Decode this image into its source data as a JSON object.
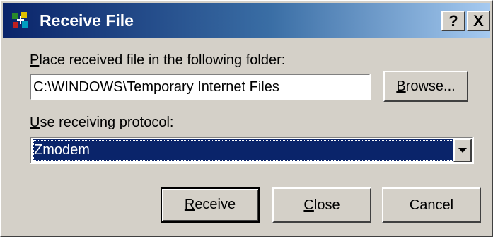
{
  "window": {
    "title": "Receive File",
    "help_label": "?",
    "close_label": "X"
  },
  "folder": {
    "label_accel": "P",
    "label_rest": "lace received file in the following folder:",
    "value": "C:\\WINDOWS\\Temporary Internet Files"
  },
  "browse_button": {
    "accel": "B",
    "rest": "rowse..."
  },
  "protocol": {
    "label_accel": "U",
    "label_rest": "se receiving protocol:",
    "selected": "Zmodem"
  },
  "buttons": {
    "receive": {
      "accel": "R",
      "rest": "eceive"
    },
    "close": {
      "accel": "C",
      "rest": "lose"
    },
    "cancel": "Cancel"
  },
  "colors": {
    "title_gradient_start": "#0a246a",
    "title_gradient_end": "#a6caf0",
    "dialog_face": "#d4d0c8",
    "selection": "#0a246a"
  },
  "icons": {
    "app": "hyperterminal-icon",
    "dropdown": "chevron-down-icon"
  }
}
